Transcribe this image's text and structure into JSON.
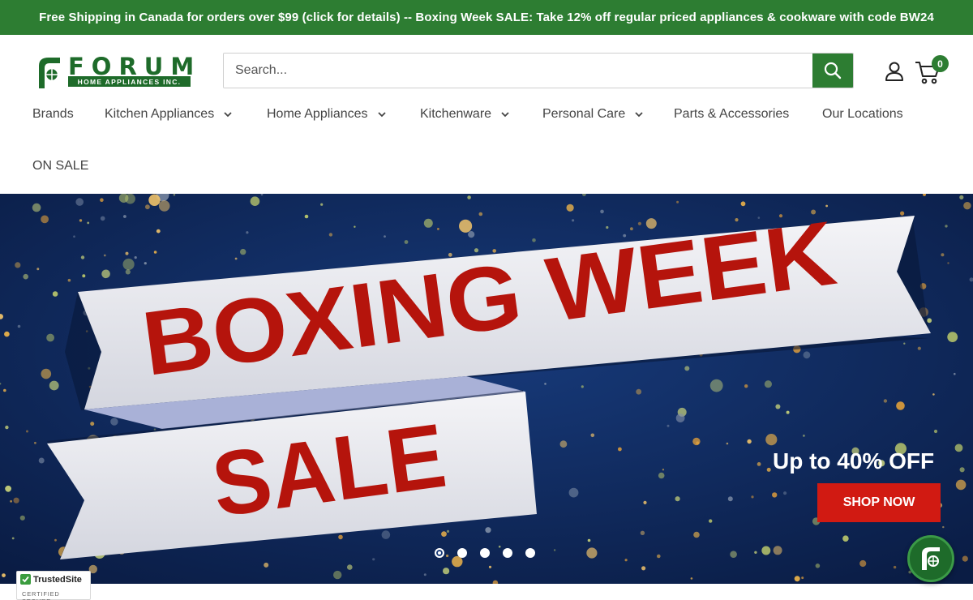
{
  "promo_bar": {
    "text": "Free Shipping in Canada for orders over $99 (click for details) -- Boxing Week SALE: Take 12% off regular priced appliances & cookware with code BW24"
  },
  "logo": {
    "wordmark": "FORUM",
    "subtitle": "HOME APPLIANCES INC."
  },
  "search": {
    "placeholder": "Search...",
    "value": "",
    "button_icon": "search-icon"
  },
  "header_icons": {
    "account": "user-icon",
    "cart": "cart-icon",
    "cart_count": "0"
  },
  "nav": {
    "items": [
      {
        "label": "Brands",
        "dropdown": false
      },
      {
        "label": "Kitchen Appliances",
        "dropdown": true
      },
      {
        "label": "Home Appliances",
        "dropdown": true
      },
      {
        "label": "Kitchenware",
        "dropdown": true
      },
      {
        "label": "Personal Care",
        "dropdown": true
      },
      {
        "label": "Parts & Accessories",
        "dropdown": false
      },
      {
        "label": "Our Locations",
        "dropdown": false
      },
      {
        "label": "ON SALE",
        "dropdown": false
      }
    ]
  },
  "hero": {
    "headline_line1": "BOXING WEEK",
    "headline_line2": "SALE",
    "offer": "Up to 40% OFF",
    "cta": "SHOP NOW",
    "slide_count": 5,
    "active_slide": 1,
    "colors": {
      "background": "#0d2452",
      "headline": "#b5140c",
      "ribbon": "#e9eaf0",
      "cta": "#d11a12"
    }
  },
  "chat": {
    "icon": "forum-chat-icon"
  },
  "trusted_badge": {
    "title": "TrustedSite",
    "subtitle": "CERTIFIED SECURE"
  },
  "colors": {
    "brand_green": "#2d7d32",
    "dark_green": "#1e6b2a"
  }
}
